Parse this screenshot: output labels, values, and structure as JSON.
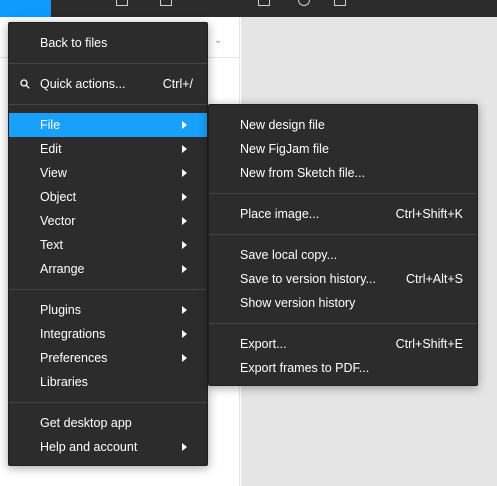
{
  "colors": {
    "menu_bg": "#2c2c2c",
    "highlight": "#18a0fb",
    "toolbar_bg": "#2c2c2c",
    "active_tool": "#0d99ff",
    "canvas_bg": "#e5e5e5"
  },
  "main_menu": {
    "back_to_files": "Back to files",
    "quick_actions": {
      "label": "Quick actions...",
      "shortcut": "Ctrl+/",
      "icon": "search-icon"
    },
    "file": "File",
    "edit": "Edit",
    "view": "View",
    "object": "Object",
    "vector": "Vector",
    "text": "Text",
    "arrange": "Arrange",
    "plugins": "Plugins",
    "integrations": "Integrations",
    "preferences": "Preferences",
    "libraries": "Libraries",
    "get_desktop_app": "Get desktop app",
    "help_and_account": "Help and account"
  },
  "file_submenu": {
    "new_design_file": "New design file",
    "new_figjam_file": "New FigJam file",
    "new_from_sketch": "New from Sketch file...",
    "place_image": {
      "label": "Place image...",
      "shortcut": "Ctrl+Shift+K"
    },
    "save_local_copy": "Save local copy...",
    "save_to_version_history": {
      "label": "Save to version history...",
      "shortcut": "Ctrl+Alt+S"
    },
    "show_version_history": "Show version history",
    "export": {
      "label": "Export...",
      "shortcut": "Ctrl+Shift+E"
    },
    "export_frames_pdf": "Export frames to PDF..."
  }
}
